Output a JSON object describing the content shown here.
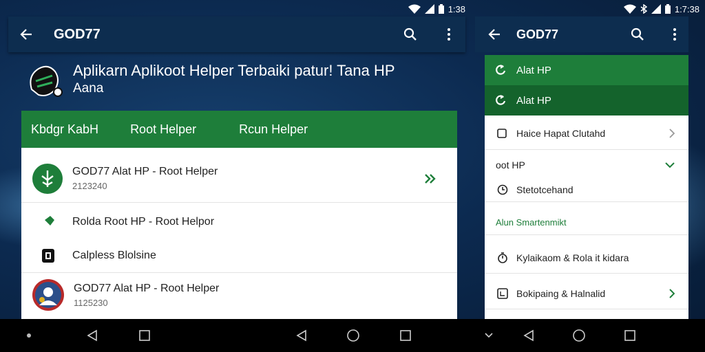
{
  "left": {
    "status": {
      "time": "1:38"
    },
    "appbar": {
      "title": "GOD77"
    },
    "hero": {
      "line1": "Aplikarn  Aplikoot Helper Terbaiki patur! Tana HP",
      "line2": "Aana"
    },
    "tabs": [
      {
        "label": "Kbdgr KabH"
      },
      {
        "label": "Root Helper"
      },
      {
        "label": "Rcun Helper"
      }
    ],
    "rows": [
      {
        "title": "GOD77 Alat HP - Root Helper",
        "sub": "2123240",
        "icon": "leaf-badge-icon",
        "trailing": "double-chevron-icon"
      },
      {
        "title": "Rolda Root HP - Root Helpor",
        "icon": "pin-icon"
      },
      {
        "title": "Calpless Blolsine",
        "icon": "square-badge-icon"
      },
      {
        "title": "GOD77 Alat HP - Root Helper",
        "sub": "1125230",
        "icon": "avatar-icon"
      }
    ]
  },
  "right": {
    "status": {
      "time": "1:7:38"
    },
    "appbar": {
      "title": "GOD77"
    },
    "green_rows": [
      {
        "label": "Alat HP",
        "icon": "refresh-icon"
      },
      {
        "label": "Alat HP",
        "icon": "refresh-icon"
      }
    ],
    "items": [
      {
        "label": "Haice Hapat Clutahd",
        "icon": "checkbox-icon",
        "trailing": "chevron-right-icon"
      },
      {
        "label": "oot HP",
        "trailing": "chevron-down-icon"
      },
      {
        "label": "Stetotcehand",
        "icon": "clock-icon"
      },
      {
        "label": "Alun Smartenmikt",
        "section": true
      },
      {
        "label": "Kylaikaom & Rola it kidara",
        "icon": "timer-icon"
      },
      {
        "label": "Bokipaing & Halnalid",
        "icon": "box-icon",
        "trailing": "chevron-right-icon"
      }
    ]
  },
  "colors": {
    "green": "#1e7e3a",
    "green_dark": "#14632c",
    "appbar": "#0d2d4f"
  }
}
